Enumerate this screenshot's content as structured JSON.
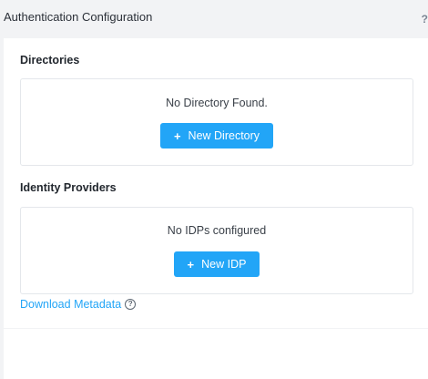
{
  "header": {
    "title": "Authentication Configuration",
    "help_glyph": "?"
  },
  "directories": {
    "title": "Directories",
    "empty_text": "No Directory Found.",
    "button_label": "New Directory",
    "button_icon": "+"
  },
  "idps": {
    "title": "Identity Providers",
    "empty_text": "No IDPs configured",
    "button_label": "New IDP",
    "button_icon": "+"
  },
  "download": {
    "label": "Download Metadata",
    "help_glyph": "?"
  },
  "colors": {
    "accent": "#22a5f7",
    "background": "#f2f3f5",
    "panel": "#ffffff"
  }
}
